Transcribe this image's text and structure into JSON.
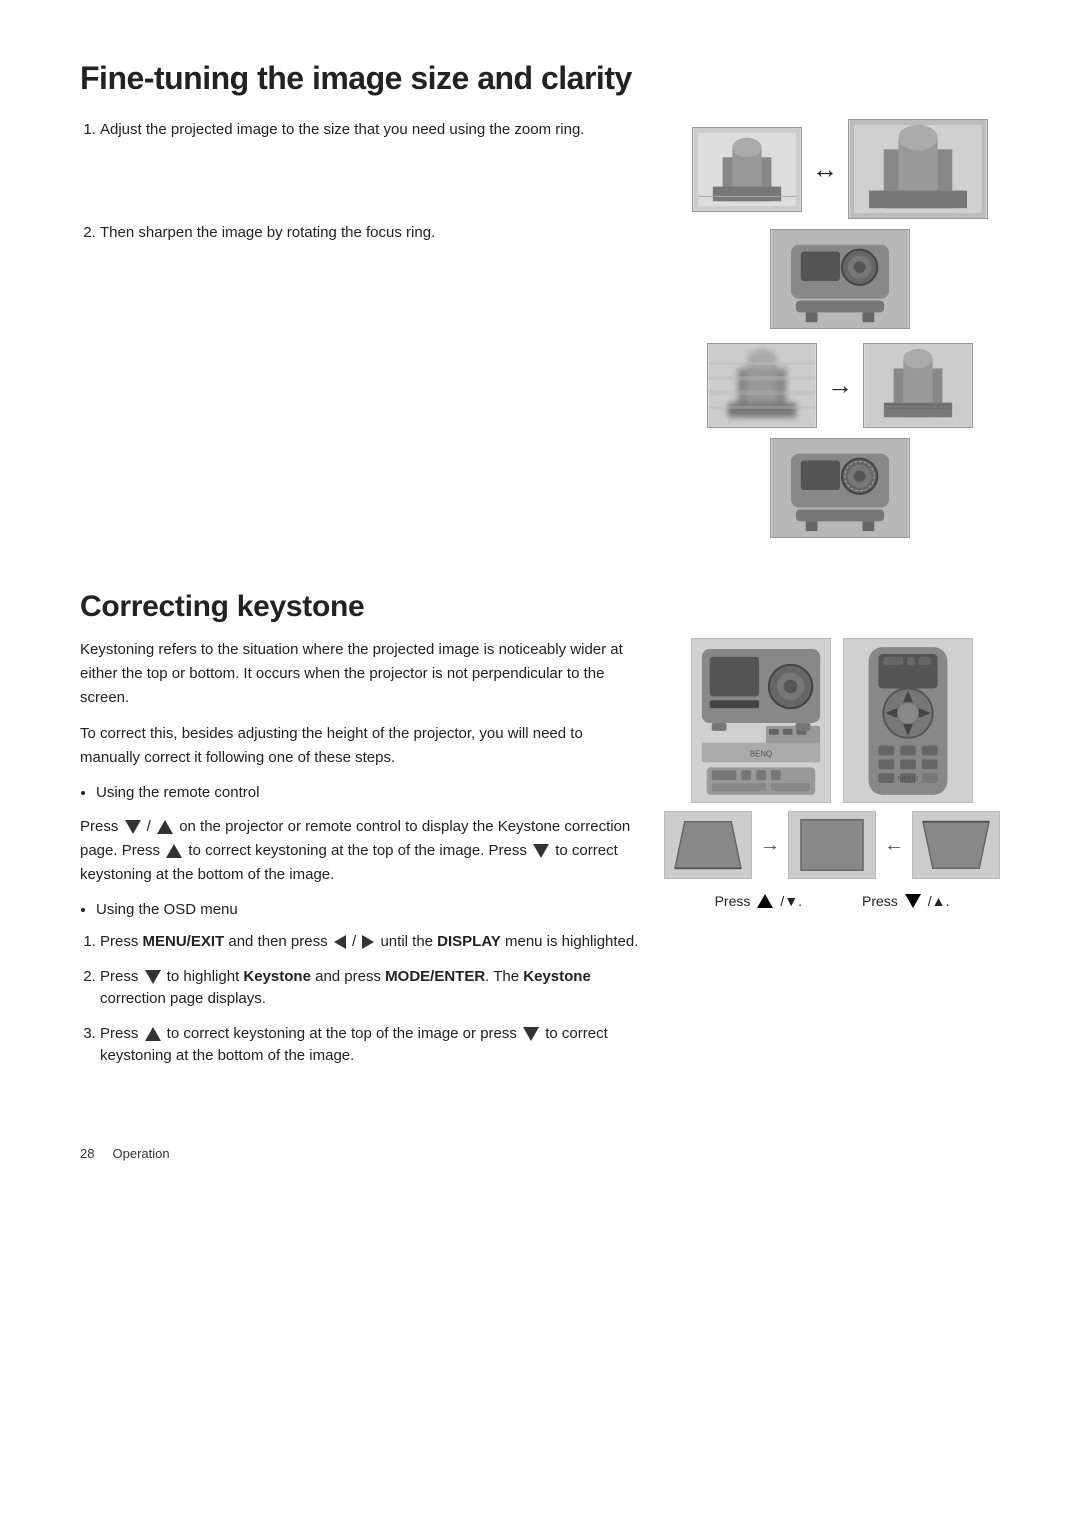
{
  "page": {
    "page_number": "28",
    "page_label": "Operation"
  },
  "fine_tuning": {
    "title": "Fine-tuning the image size and clarity",
    "steps": [
      {
        "number": "1",
        "text": "Adjust the projected image to the size that you need using the zoom ring."
      },
      {
        "number": "2",
        "text": "Then sharpen the image by rotating the focus ring."
      }
    ]
  },
  "keystone": {
    "title": "Correcting keystone",
    "intro1": "Keystoning refers to the situation where the projected image is noticeably wider at either the top or bottom. It occurs when the projector is not perpendicular to the screen.",
    "intro2": "To correct this, besides adjusting the height of the projector, you will need to manually correct it following one of these steps.",
    "bullet1": "Using the remote control",
    "press_text1": "Press",
    "press_symbol1": "▼/▲",
    "press_text2": "on the projector or remote control to display the Keystone correction page.",
    "press_text3": "Press",
    "press_symbol2": "▲",
    "press_text4": "to correct keystoning at the top of the image. Press",
    "press_symbol3": "▼",
    "press_text5": "to correct keystoning at the bottom of the image.",
    "bullet2": "Using the OSD menu",
    "osd_steps": [
      {
        "number": "1",
        "text_before": "Press ",
        "bold1": "MENU/EXIT",
        "text_mid": " and then press ",
        "symbol": "◄/►",
        "text_after": " until the ",
        "bold2": "DISPLAY",
        "text_end": " menu is highlighted."
      },
      {
        "number": "2",
        "text_before": "Press ",
        "symbol": "▼",
        "text_mid": " to highlight ",
        "bold1": "Keystone",
        "text_mid2": " and press ",
        "bold2": "MODE/ENTER",
        "text_end": ". The ",
        "bold3": "Keystone",
        "text_end2": " correction page displays."
      },
      {
        "number": "3",
        "text_before": "Press ",
        "symbol": "▲",
        "text_mid": " to correct keystoning at the top of the image or press ",
        "symbol2": "▼",
        "text_end": " to correct keystoning at the bottom of the image."
      }
    ],
    "press_label1": "Press",
    "press_label1_sym": "▲ /▼.",
    "press_label2": "Press",
    "press_label2_sym": "▼ /▲."
  }
}
